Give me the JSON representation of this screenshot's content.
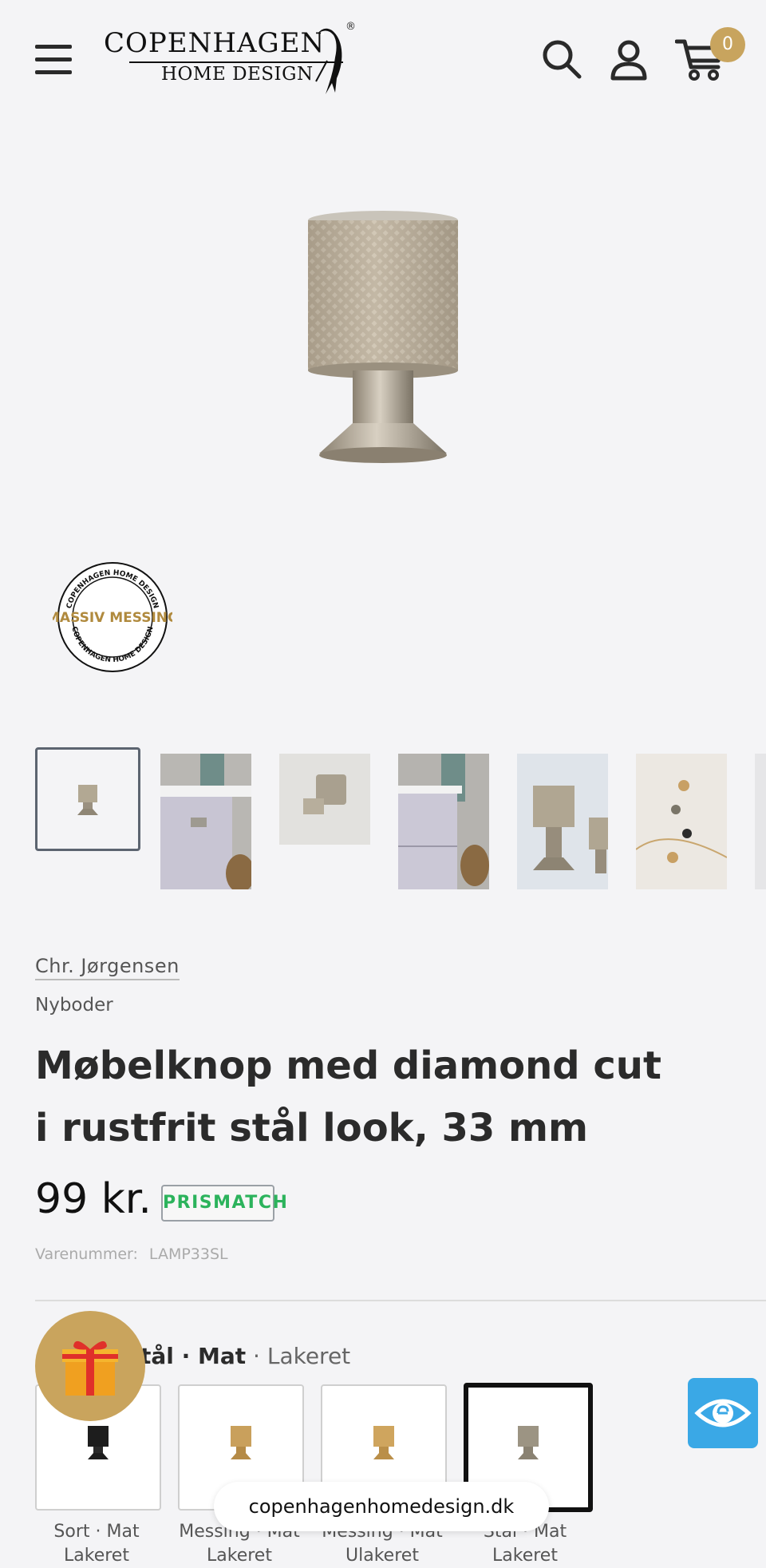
{
  "header": {
    "logo_line1": "COPENHAGEN",
    "logo_line2": "HOME DESIGN",
    "logo_mark": "®",
    "cart_count": "0",
    "icons": [
      "menu-icon",
      "search-icon",
      "account-icon",
      "cart-icon"
    ]
  },
  "media": {
    "seal_top_text": "COPENHAGEN HOME DESIGN",
    "seal_center_text": "MASSIV MESSING",
    "seal_bottom_text": "COPENHAGEN HOME DESIGN",
    "thumbnail_count": 7
  },
  "product": {
    "vendor": "Chr. Jørgensen",
    "collection": "Nyboder",
    "title": "Møbelknop med diamond cut i rustfrit stål look, 33 mm",
    "price": "99 kr.",
    "price_badge": "PRISMATCH",
    "sku_label": "Varenummer:",
    "sku_value": "LAMP33SL"
  },
  "variant": {
    "label_bold": "tål · Mat",
    "label_light": " · Lakeret",
    "swatches": [
      {
        "caption1": "Sort · Mat",
        "caption2": "Lakeret",
        "selected": false
      },
      {
        "caption1": "Messing · Mat",
        "caption2": "Lakeret",
        "selected": false
      },
      {
        "caption1": "Messing · Mat",
        "caption2": "Ulakeret",
        "selected": false
      },
      {
        "caption1": "Stål · Mat",
        "caption2": "Lakeret",
        "selected": true
      }
    ]
  },
  "browser": {
    "url": "copenhagenhomedesign.dk"
  },
  "colors": {
    "accent_gold": "#c8a45e",
    "prismatch_green": "#2cb35c",
    "eye_blue": "#3aa8e6"
  }
}
